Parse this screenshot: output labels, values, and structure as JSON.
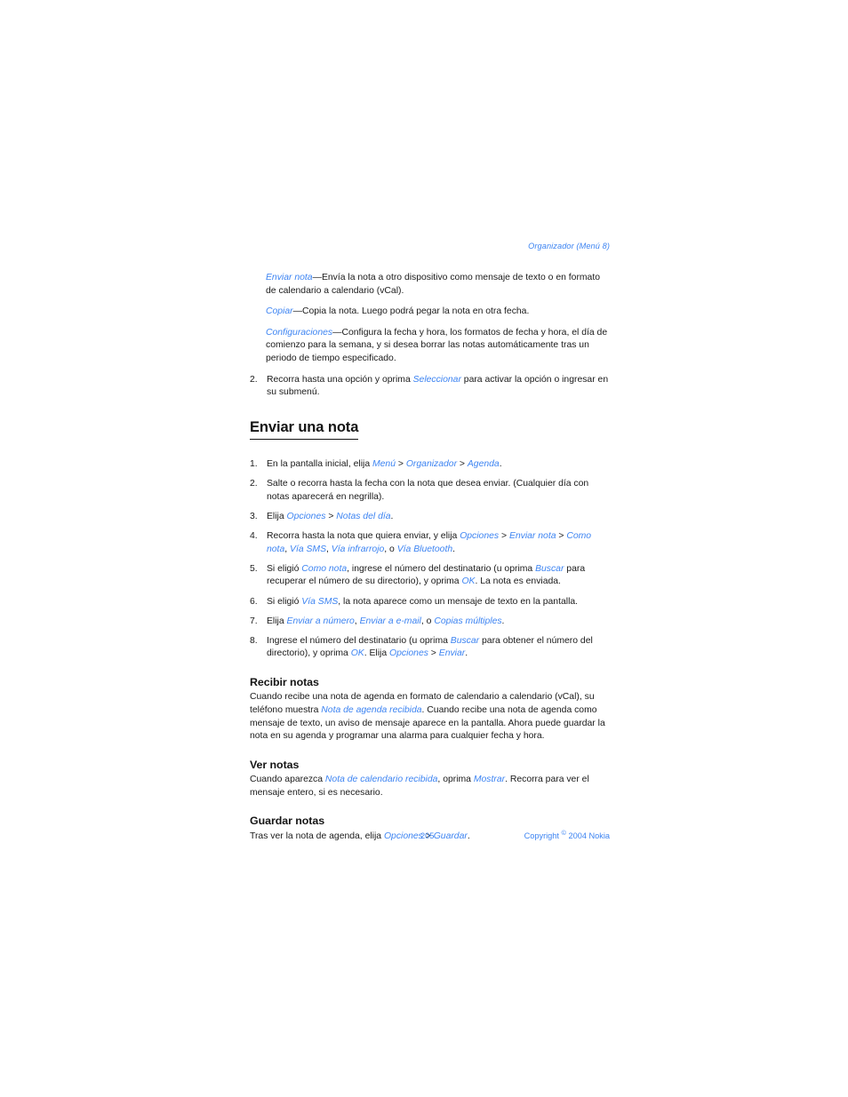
{
  "running_head": "Organizador (Menú 8)",
  "intro": {
    "items": [
      {
        "term": "Enviar nota",
        "dash": "—",
        "text": "Envía la nota a otro dispositivo como mensaje de texto o en formato de calendario a calendario (vCal)."
      },
      {
        "term": "Copiar",
        "dash": "—",
        "text": "Copia la nota. Luego podrá pegar la nota en otra fecha."
      },
      {
        "term": "Configuraciones",
        "dash": "—",
        "text": "Configura la fecha y hora, los formatos de fecha y hora, el día de comienzo para la semana, y si desea borrar las notas automáticamente tras un periodo de tiempo especificado."
      }
    ],
    "step2": {
      "num": "2.",
      "pre": "Recorra hasta una opción y oprima ",
      "lit1": "Seleccionar",
      "post": " para activar la opción o ingresar en su submenú."
    }
  },
  "section": {
    "title": "Enviar una nota",
    "steps": [
      {
        "num": "1.",
        "parts": [
          {
            "t": "text",
            "v": "En la pantalla inicial, elija "
          },
          {
            "t": "lit",
            "v": "Menú"
          },
          {
            "t": "text",
            "v": " > "
          },
          {
            "t": "lit",
            "v": "Organizador"
          },
          {
            "t": "text",
            "v": " > "
          },
          {
            "t": "lit",
            "v": "Agenda"
          },
          {
            "t": "text",
            "v": "."
          }
        ]
      },
      {
        "num": "2.",
        "parts": [
          {
            "t": "text",
            "v": "Salte o recorra hasta la fecha con la nota que desea enviar. (Cualquier día con notas aparecerá en negrilla)."
          }
        ]
      },
      {
        "num": "3.",
        "parts": [
          {
            "t": "text",
            "v": "Elija "
          },
          {
            "t": "lit",
            "v": "Opciones"
          },
          {
            "t": "text",
            "v": " > "
          },
          {
            "t": "lit",
            "v": "Notas del día"
          },
          {
            "t": "text",
            "v": "."
          }
        ]
      },
      {
        "num": "4.",
        "parts": [
          {
            "t": "text",
            "v": "Recorra hasta la nota que quiera enviar, y elija "
          },
          {
            "t": "lit",
            "v": "Opciones"
          },
          {
            "t": "text",
            "v": " > "
          },
          {
            "t": "lit",
            "v": "Enviar nota"
          },
          {
            "t": "text",
            "v": " > "
          },
          {
            "t": "lit",
            "v": "Como nota"
          },
          {
            "t": "text",
            "v": ", "
          },
          {
            "t": "lit",
            "v": "Vía SMS"
          },
          {
            "t": "text",
            "v": ", "
          },
          {
            "t": "lit",
            "v": "Vía infrarrojo"
          },
          {
            "t": "text",
            "v": ", o "
          },
          {
            "t": "lit",
            "v": "Vía Bluetooth"
          },
          {
            "t": "text",
            "v": "."
          }
        ]
      },
      {
        "num": "5.",
        "parts": [
          {
            "t": "text",
            "v": "Si eligió "
          },
          {
            "t": "lit",
            "v": "Como nota"
          },
          {
            "t": "text",
            "v": ", ingrese el número del destinatario (u oprima "
          },
          {
            "t": "lit",
            "v": "Buscar"
          },
          {
            "t": "text",
            "v": " para recuperar el número de su directorio), y oprima "
          },
          {
            "t": "lit",
            "v": "OK"
          },
          {
            "t": "text",
            "v": ". La nota es enviada."
          }
        ]
      },
      {
        "num": "6.",
        "parts": [
          {
            "t": "text",
            "v": "Si eligió "
          },
          {
            "t": "lit",
            "v": "Vía SMS"
          },
          {
            "t": "text",
            "v": ", la nota aparece como un mensaje de texto en la pantalla."
          }
        ]
      },
      {
        "num": "7.",
        "parts": [
          {
            "t": "text",
            "v": "Elija "
          },
          {
            "t": "lit",
            "v": "Enviar a número"
          },
          {
            "t": "text",
            "v": ", "
          },
          {
            "t": "lit",
            "v": "Enviar a e-mail"
          },
          {
            "t": "text",
            "v": ", o "
          },
          {
            "t": "lit",
            "v": "Copias múltiples"
          },
          {
            "t": "text",
            "v": "."
          }
        ]
      },
      {
        "num": "8.",
        "parts": [
          {
            "t": "text",
            "v": "Ingrese el número del destinatario (u oprima "
          },
          {
            "t": "lit",
            "v": "Buscar"
          },
          {
            "t": "text",
            "v": " para obtener el número del directorio), y oprima "
          },
          {
            "t": "lit",
            "v": "OK"
          },
          {
            "t": "text",
            "v": ". Elija "
          },
          {
            "t": "lit",
            "v": "Opciones"
          },
          {
            "t": "text",
            "v": " > "
          },
          {
            "t": "lit",
            "v": "Enviar"
          },
          {
            "t": "text",
            "v": "."
          }
        ]
      }
    ]
  },
  "subsections": [
    {
      "heading": "Recibir notas",
      "parts": [
        {
          "t": "text",
          "v": "Cuando recibe una nota de agenda en formato de calendario a calendario (vCal), su teléfono muestra "
        },
        {
          "t": "lit",
          "v": "Nota de agenda recibida"
        },
        {
          "t": "text",
          "v": ". Cuando recibe una nota de agenda como mensaje de texto, un aviso de mensaje aparece en la pantalla. Ahora puede guardar la nota en su agenda y programar una alarma para cualquier fecha y hora."
        }
      ]
    },
    {
      "heading": "Ver notas",
      "parts": [
        {
          "t": "text",
          "v": "Cuando aparezca "
        },
        {
          "t": "lit",
          "v": "Nota de calendario recibida"
        },
        {
          "t": "text",
          "v": ", oprima "
        },
        {
          "t": "lit",
          "v": "Mostrar"
        },
        {
          "t": "text",
          "v": ". Recorra para ver el mensaje entero, si es necesario."
        }
      ]
    },
    {
      "heading": "Guardar notas",
      "parts": [
        {
          "t": "text",
          "v": "Tras ver la nota de agenda, elija "
        },
        {
          "t": "lit",
          "v": "Opciones"
        },
        {
          "t": "text",
          "v": " > "
        },
        {
          "t": "lit",
          "v": "Guardar"
        },
        {
          "t": "text",
          "v": "."
        }
      ]
    }
  ],
  "footer": {
    "page_number": "205",
    "copyright_pre": "Copyright ",
    "copyright_sym": "©",
    "copyright_post": " 2004 Nokia"
  },
  "colors": {
    "link_blue": "#3d84f2",
    "body_black": "#1a1a1a",
    "page_background": "#ffffff"
  }
}
